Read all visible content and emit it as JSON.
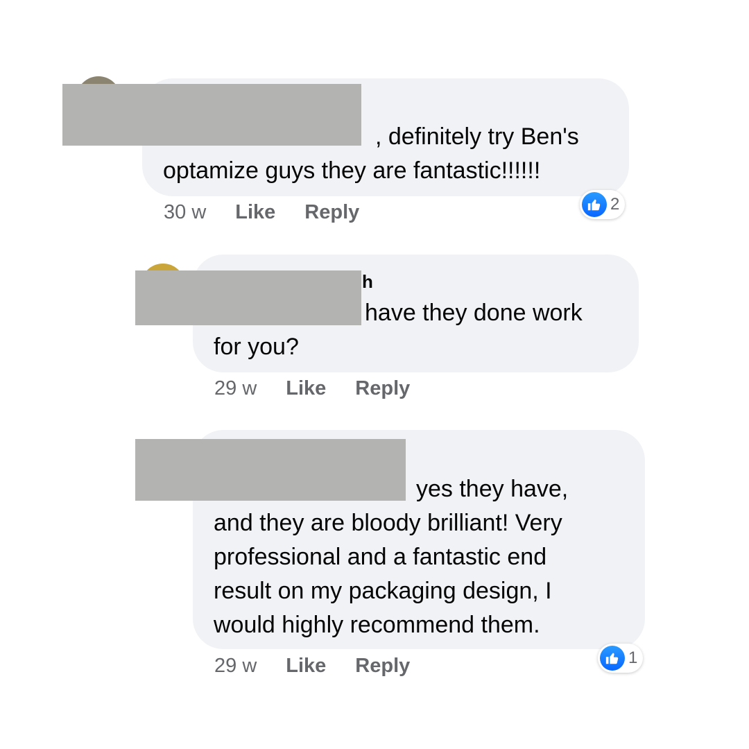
{
  "comments": [
    {
      "author": "",
      "text_lines": [
        ", definitely try Ben's",
        "optamize guys they are fantastic!!!!!!"
      ],
      "time": "30 w",
      "like_label": "Like",
      "reply_label": "Reply",
      "reaction_count": "2"
    },
    {
      "author": "h",
      "text_lines": [
        "have they done work",
        "for you?"
      ],
      "time": "29 w",
      "like_label": "Like",
      "reply_label": "Reply",
      "reaction_count": ""
    },
    {
      "author": "",
      "text_lines": [
        "yes they have,",
        "and they are bloody brilliant! Very",
        "professional and a fantastic end",
        "result on my packaging design, I",
        "would highly recommend them."
      ],
      "time": "29 w",
      "like_label": "Like",
      "reply_label": "Reply",
      "reaction_count": "1"
    }
  ],
  "colors": {
    "bubble": "#f0f2f5",
    "meta_text": "#65676b",
    "like_blue": "#0866ff",
    "redaction": "#b3b3b2"
  },
  "icons": [
    "like-thumb-icon"
  ]
}
